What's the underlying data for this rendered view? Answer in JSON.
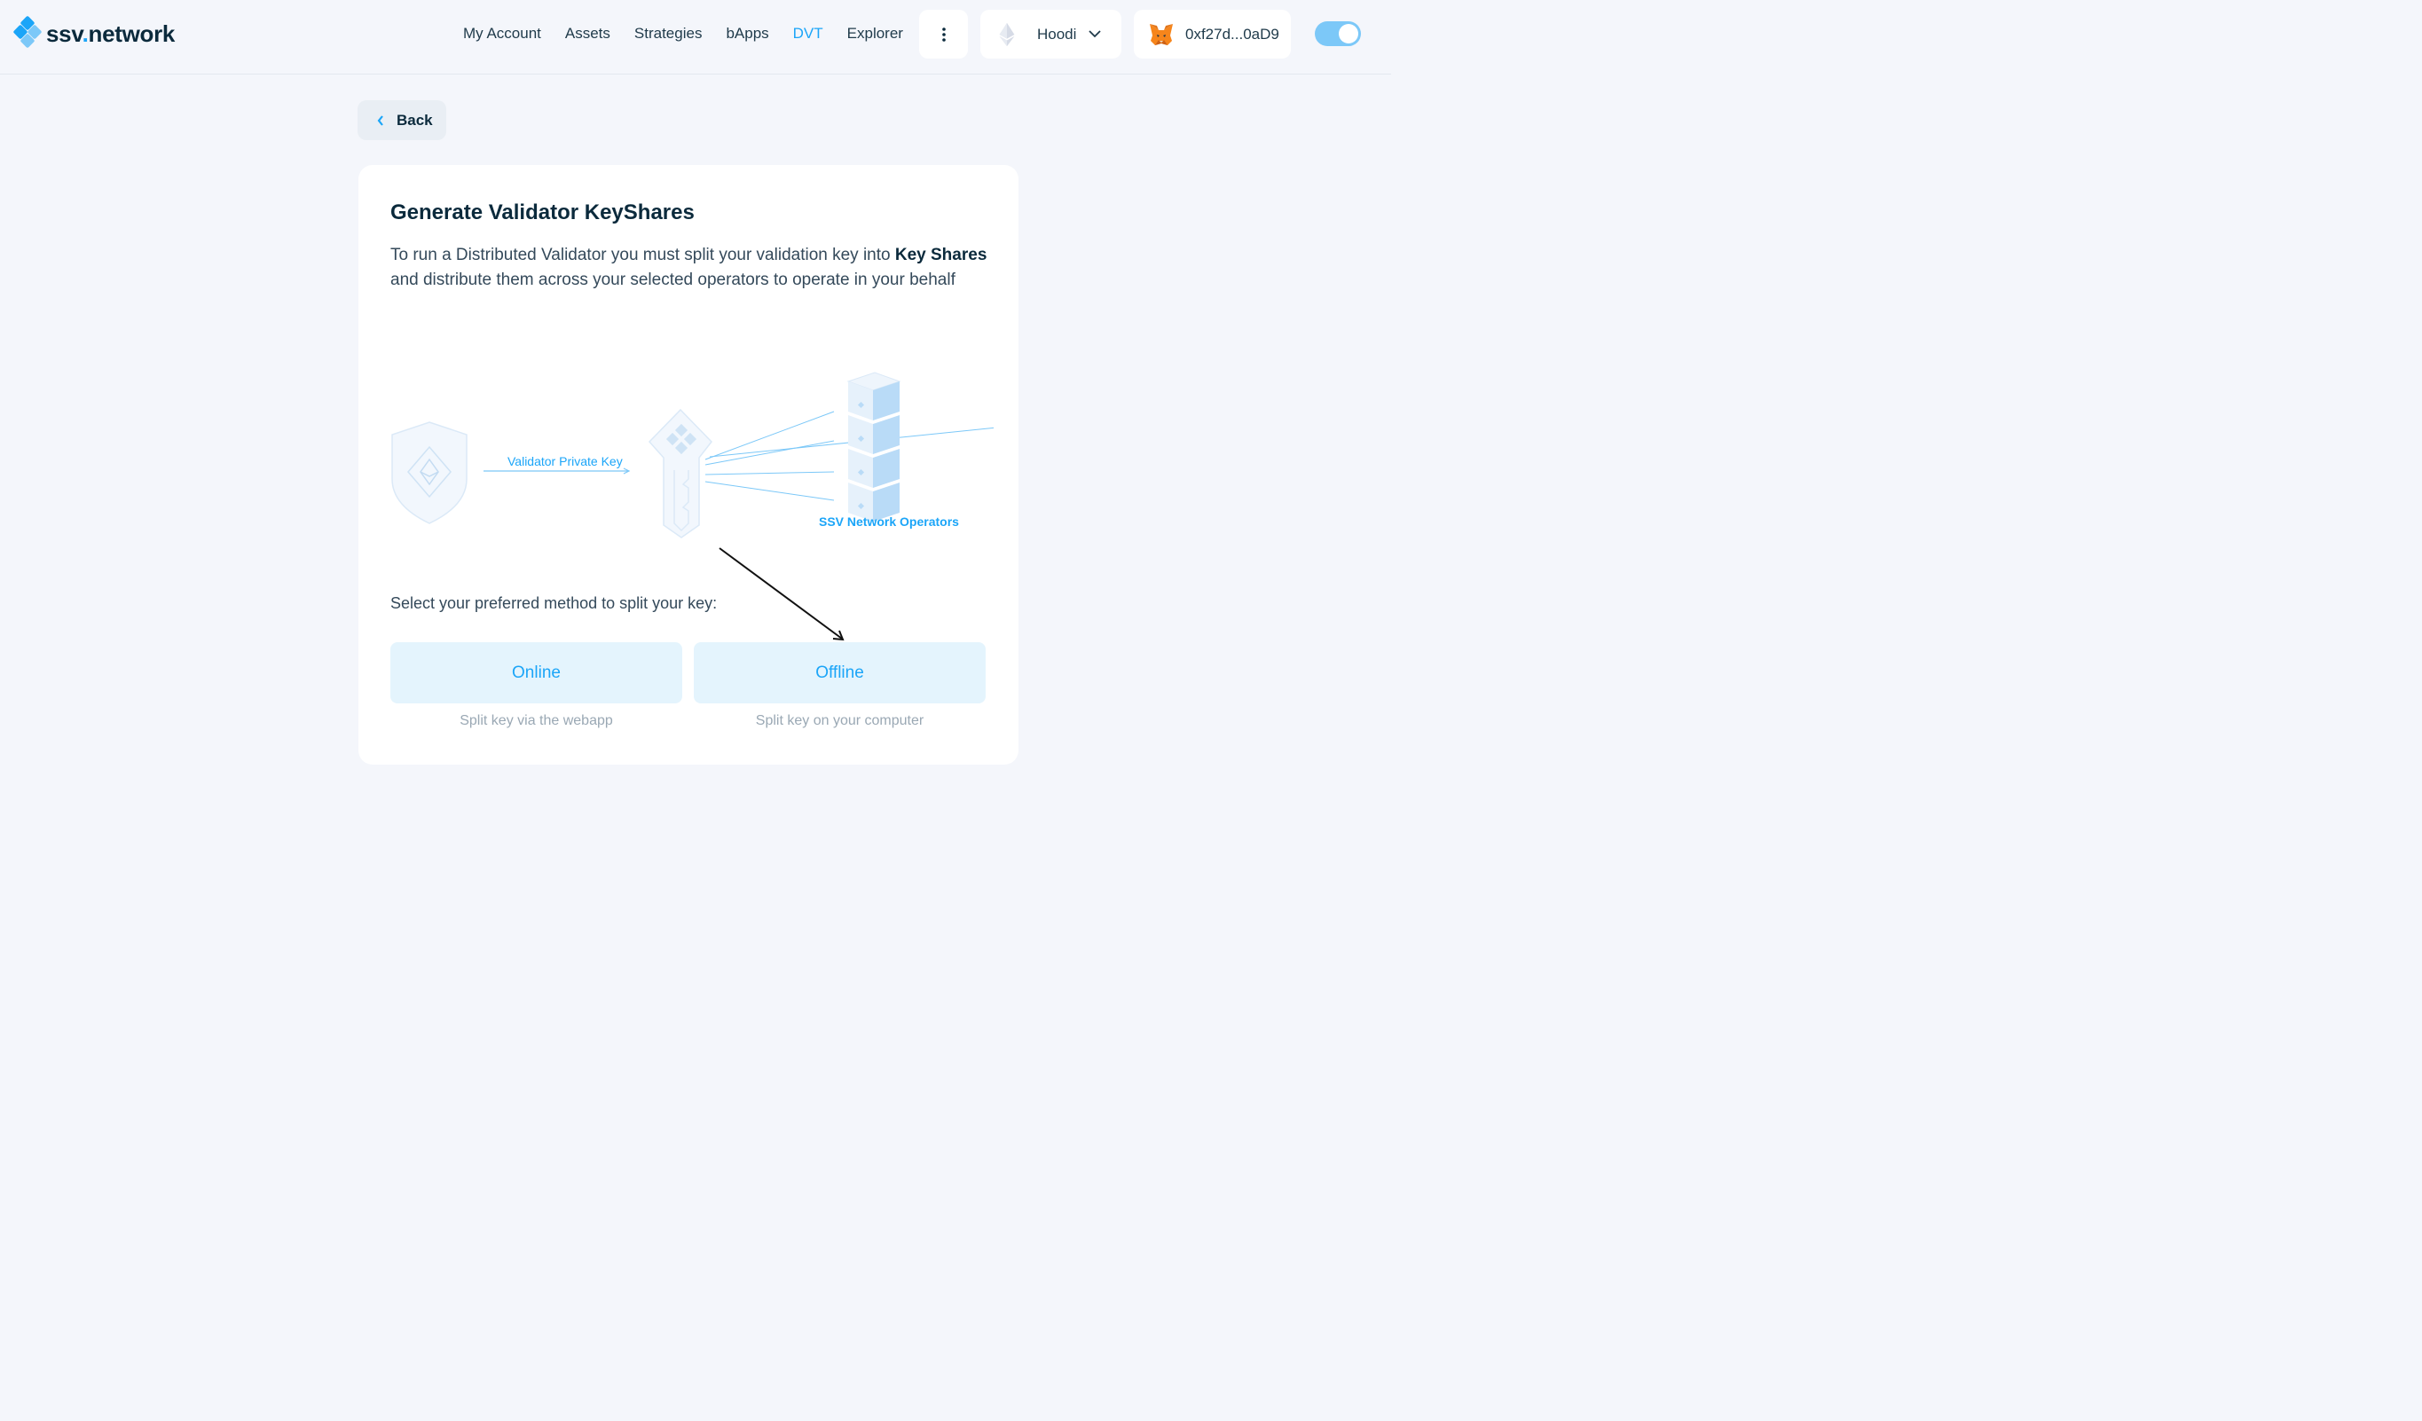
{
  "brand": {
    "logo_text_main": "ssv",
    "logo_text_dot": ".",
    "logo_text_tail": "network",
    "accent_color": "#1ba5f8"
  },
  "nav": {
    "items": [
      {
        "label": "My Account",
        "active": false
      },
      {
        "label": "Assets",
        "active": false
      },
      {
        "label": "Strategies",
        "active": false
      },
      {
        "label": "bApps",
        "active": false
      },
      {
        "label": "DVT",
        "active": true
      },
      {
        "label": "Explorer",
        "active": false
      }
    ],
    "more_icon": "vertical-dots-icon"
  },
  "network": {
    "label": "Hoodi",
    "icon": "ethereum-icon"
  },
  "wallet": {
    "address": "0xf27d...0aD9",
    "icon": "metamask-fox-icon"
  },
  "theme_toggle": {
    "state": "on"
  },
  "back": {
    "label": "Back"
  },
  "card": {
    "title": "Generate Validator KeyShares",
    "desc_part1": "To run a Distributed Validator you must split your validation key into ",
    "desc_bold": "Key Shares",
    "desc_part2": " and distribute them across your selected operators to operate in your behalf",
    "illustration": {
      "arrow_label": "Validator Private Key",
      "operators_label": "SSV Network Operators"
    },
    "select_label": "Select your preferred method to split your key:",
    "methods": [
      {
        "label": "Online",
        "sub": "Split key via the webapp"
      },
      {
        "label": "Offline",
        "sub": "Split key on your computer"
      }
    ]
  }
}
